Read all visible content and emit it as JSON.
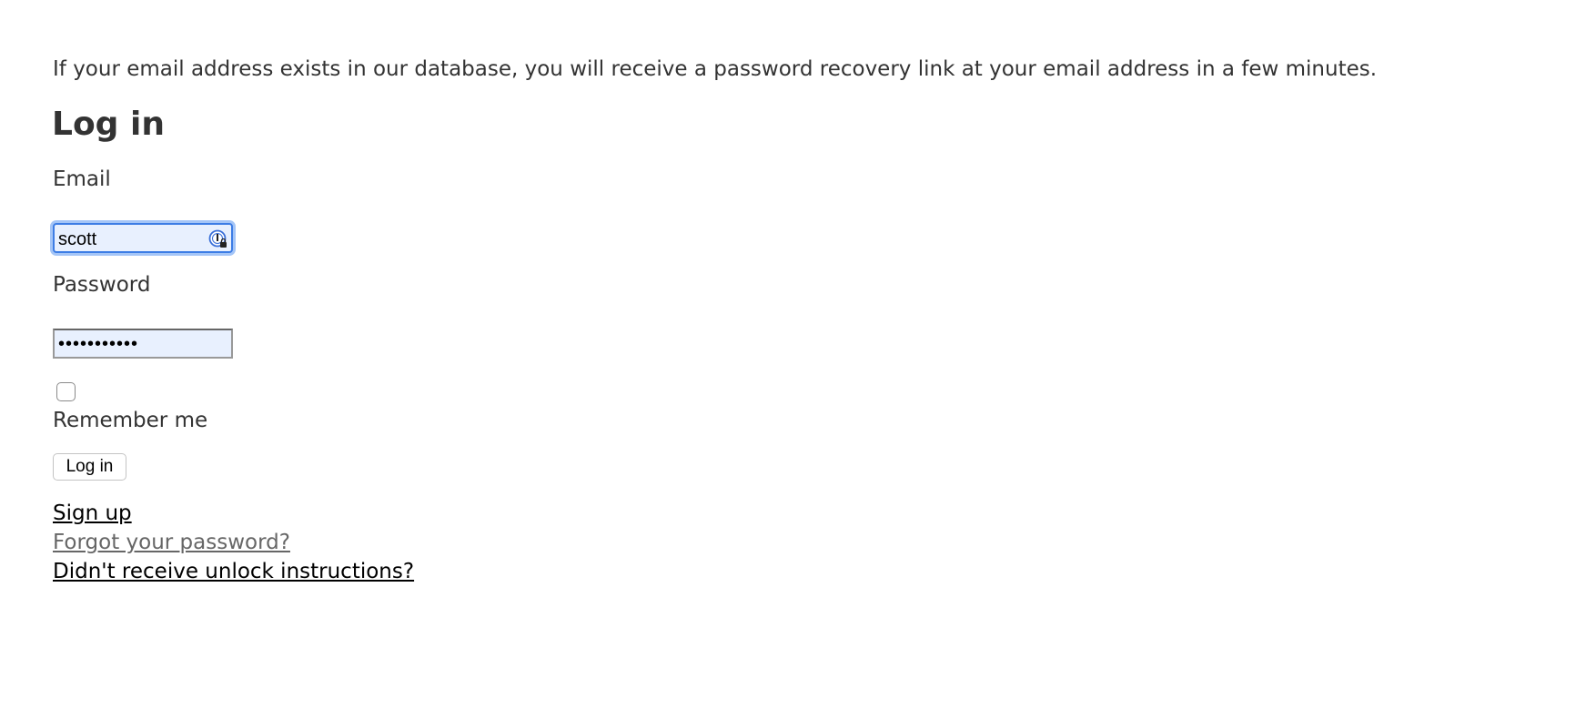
{
  "notice": "If your email address exists in our database, you will receive a password recovery link at your email address in a few minutes.",
  "form": {
    "title": "Log in",
    "email_label": "Email",
    "email_value": "scott",
    "password_label": "Password",
    "password_value": "•••••••••••",
    "remember_label": "Remember me",
    "remember_checked": false,
    "submit_label": "Log in"
  },
  "links": {
    "sign_up": "Sign up",
    "forgot_password": "Forgot your password?",
    "unlock": "Didn't receive unlock instructions?"
  },
  "icons": {
    "password_manager": "password-manager-icon"
  },
  "colors": {
    "focus_ring": "#3d7de5",
    "autofill_background": "#e8f0fe",
    "text": "#333333",
    "visited_link": "#666666"
  }
}
